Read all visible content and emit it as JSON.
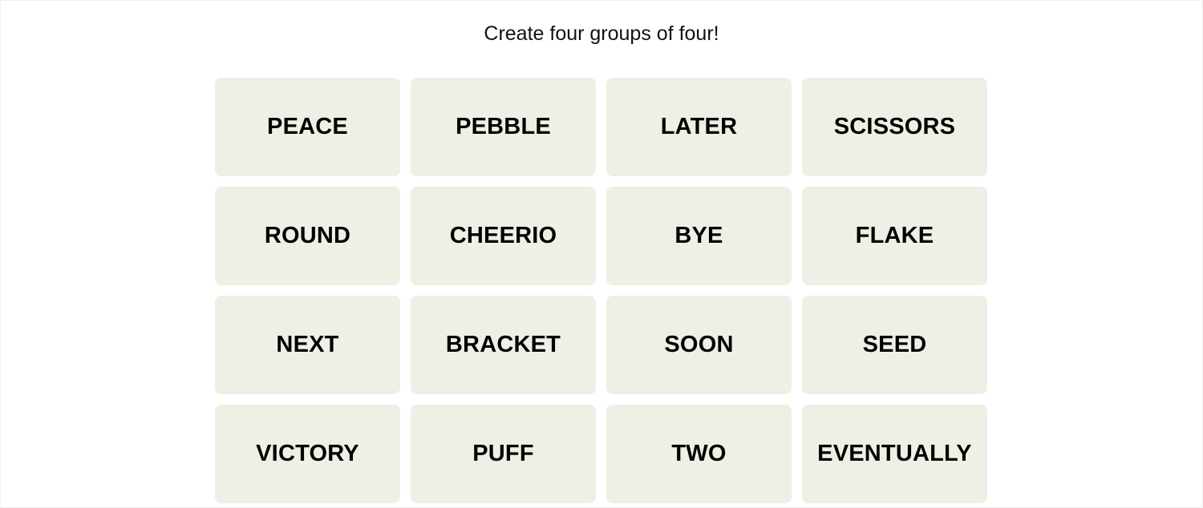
{
  "instructions": "Create four groups of four!",
  "colors": {
    "tile_bg": "#efefe6",
    "tile_text": "#000000"
  },
  "tiles": [
    "PEACE",
    "PEBBLE",
    "LATER",
    "SCISSORS",
    "ROUND",
    "CHEERIO",
    "BYE",
    "FLAKE",
    "NEXT",
    "BRACKET",
    "SOON",
    "SEED",
    "VICTORY",
    "PUFF",
    "TWO",
    "EVENTUALLY"
  ]
}
